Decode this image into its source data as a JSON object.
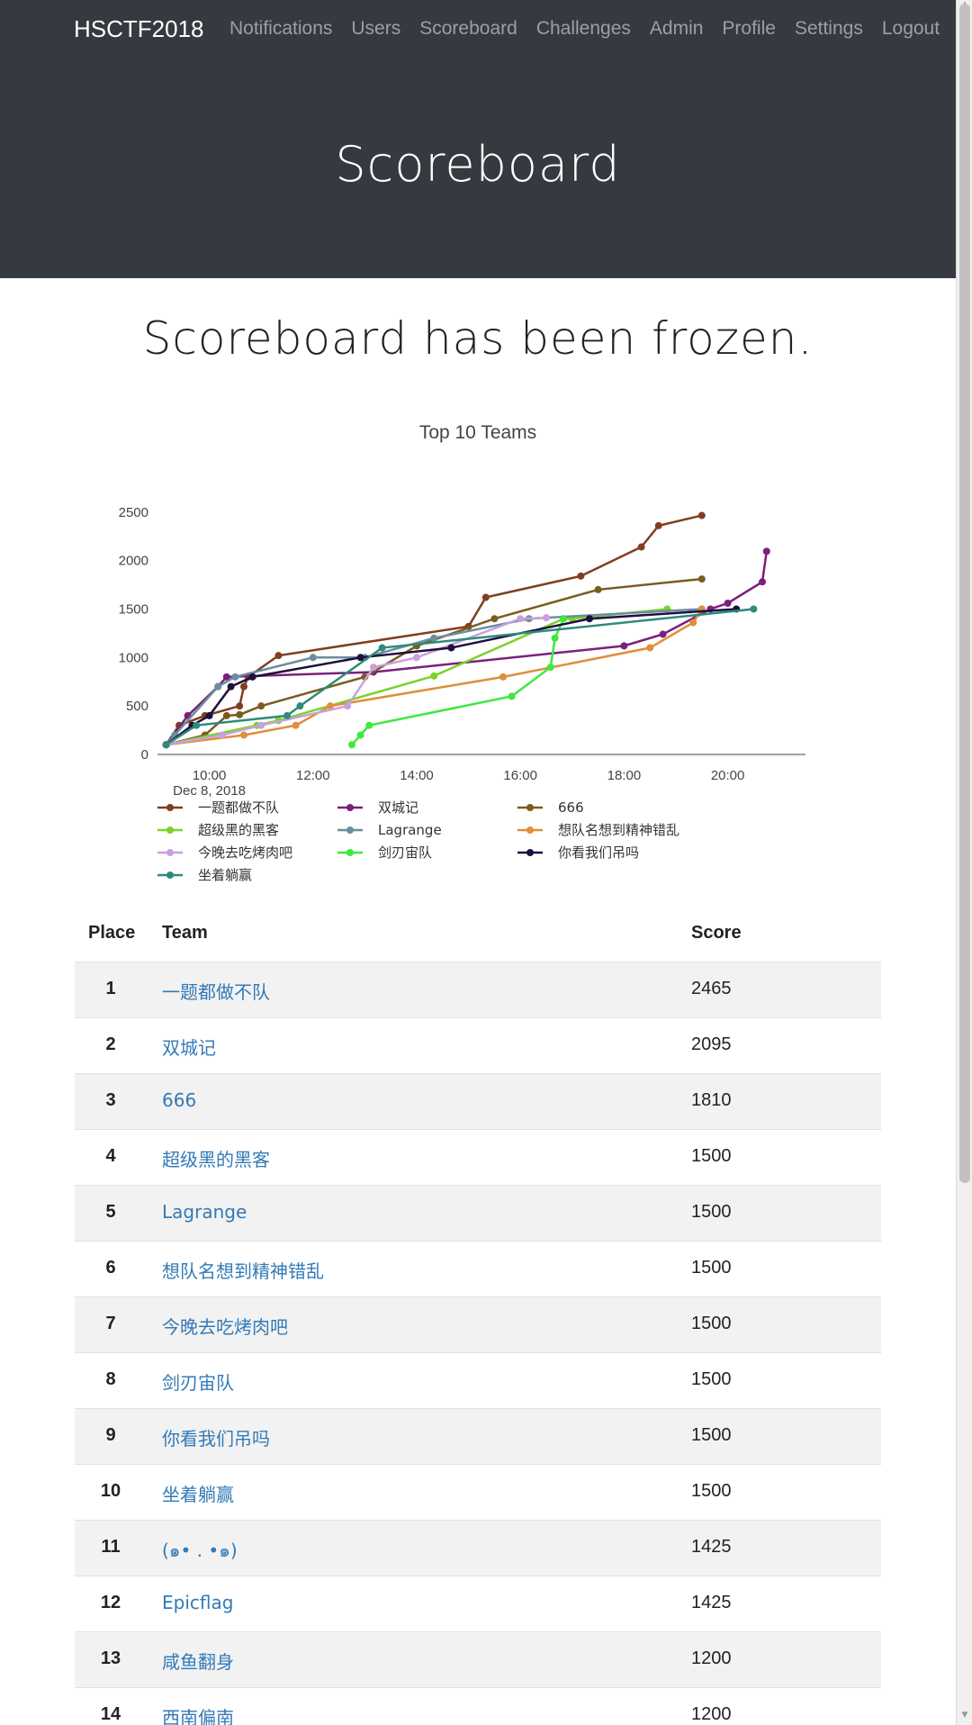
{
  "navbar": {
    "brand": "HSCTF2018",
    "links": [
      "Notifications",
      "Users",
      "Scoreboard",
      "Challenges",
      "Admin",
      "Profile",
      "Settings",
      "Logout"
    ]
  },
  "hero": {
    "title": "Scoreboard"
  },
  "notice": "Scoreboard has been frozen.",
  "chart_data": {
    "type": "line",
    "title": "Top 10 Teams",
    "xlabel": "",
    "ylabel": "",
    "x_axis_type": "time",
    "x_ticks": [
      "10:00",
      "12:00",
      "14:00",
      "16:00",
      "18:00",
      "20:00"
    ],
    "x_date_label": "Dec 8, 2018",
    "xlim": [
      "09:00",
      "21:30"
    ],
    "y_ticks": [
      0,
      500,
      1000,
      1500,
      2000,
      2500
    ],
    "ylim": [
      0,
      2600
    ],
    "grid": false,
    "legend_position": "bottom",
    "series": [
      {
        "name": "一题都做不队",
        "color": "#7f3f1f",
        "points": [
          [
            "09:10",
            100
          ],
          [
            "09:25",
            300
          ],
          [
            "09:55",
            400
          ],
          [
            "10:35",
            500
          ],
          [
            "10:40",
            700
          ],
          [
            "10:45",
            800
          ],
          [
            "11:20",
            1020
          ],
          [
            "15:00",
            1320
          ],
          [
            "15:20",
            1620
          ],
          [
            "17:10",
            1840
          ],
          [
            "18:20",
            2140
          ],
          [
            "18:40",
            2360
          ],
          [
            "19:30",
            2465
          ]
        ]
      },
      {
        "name": "双城记",
        "color": "#7b1f7b",
        "points": [
          [
            "09:10",
            100
          ],
          [
            "09:35",
            400
          ],
          [
            "10:10",
            700
          ],
          [
            "10:20",
            800
          ],
          [
            "13:10",
            850
          ],
          [
            "18:00",
            1120
          ],
          [
            "18:45",
            1240
          ],
          [
            "19:40",
            1500
          ],
          [
            "20:00",
            1560
          ],
          [
            "20:40",
            1780
          ],
          [
            "20:45",
            2095
          ]
        ]
      },
      {
        "name": "666",
        "color": "#7a5c1f",
        "points": [
          [
            "09:10",
            100
          ],
          [
            "09:55",
            200
          ],
          [
            "10:20",
            400
          ],
          [
            "10:35",
            410
          ],
          [
            "11:00",
            500
          ],
          [
            "13:00",
            800
          ],
          [
            "14:00",
            1120
          ],
          [
            "15:30",
            1400
          ],
          [
            "17:30",
            1700
          ],
          [
            "19:30",
            1810
          ]
        ]
      },
      {
        "name": "超级黑的黑客",
        "color": "#7bd22c",
        "points": [
          [
            "09:10",
            100
          ],
          [
            "10:55",
            300
          ],
          [
            "11:20",
            350
          ],
          [
            "14:20",
            810
          ],
          [
            "16:50",
            1400
          ],
          [
            "17:00",
            1400
          ],
          [
            "18:50",
            1500
          ]
        ]
      },
      {
        "name": "Lagrange",
        "color": "#6b8e9e",
        "points": [
          [
            "09:10",
            100
          ],
          [
            "09:20",
            200
          ],
          [
            "10:10",
            700
          ],
          [
            "10:30",
            800
          ],
          [
            "12:00",
            1000
          ],
          [
            "13:00",
            1000
          ],
          [
            "14:20",
            1200
          ],
          [
            "16:10",
            1400
          ],
          [
            "19:30",
            1500
          ]
        ]
      },
      {
        "name": "想队名想到精神错乱",
        "color": "#e08e3a",
        "points": [
          [
            "09:10",
            100
          ],
          [
            "10:40",
            200
          ],
          [
            "11:40",
            300
          ],
          [
            "12:20",
            500
          ],
          [
            "15:40",
            800
          ],
          [
            "18:30",
            1100
          ],
          [
            "19:20",
            1360
          ],
          [
            "19:30",
            1500
          ]
        ]
      },
      {
        "name": "今晚去吃烤肉吧",
        "color": "#c9a0dc",
        "points": [
          [
            "09:10",
            100
          ],
          [
            "10:15",
            200
          ],
          [
            "11:00",
            300
          ],
          [
            "12:40",
            500
          ],
          [
            "13:10",
            900
          ],
          [
            "14:00",
            1000
          ],
          [
            "16:00",
            1400
          ],
          [
            "16:30",
            1410
          ]
        ]
      },
      {
        "name": "剑刃宙队",
        "color": "#3ee83e",
        "points": [
          [
            "12:45",
            100
          ],
          [
            "12:55",
            200
          ],
          [
            "13:05",
            300
          ],
          [
            "15:50",
            600
          ],
          [
            "16:35",
            900
          ],
          [
            "16:40",
            1200
          ],
          [
            "16:50",
            1400
          ]
        ]
      },
      {
        "name": "你看我们吊吗",
        "color": "#1f0f3f",
        "points": [
          [
            "09:10",
            100
          ],
          [
            "09:40",
            300
          ],
          [
            "10:00",
            400
          ],
          [
            "10:25",
            700
          ],
          [
            "10:50",
            800
          ],
          [
            "12:55",
            1000
          ],
          [
            "14:40",
            1100
          ],
          [
            "17:20",
            1400
          ],
          [
            "20:10",
            1500
          ]
        ]
      },
      {
        "name": "坐着躺赢",
        "color": "#2e8b7a",
        "points": [
          [
            "09:10",
            100
          ],
          [
            "09:45",
            300
          ],
          [
            "11:30",
            400
          ],
          [
            "11:45",
            500
          ],
          [
            "13:20",
            1100
          ],
          [
            "20:30",
            1500
          ]
        ]
      }
    ]
  },
  "table": {
    "headers": {
      "place": "Place",
      "team": "Team",
      "score": "Score"
    },
    "rows": [
      {
        "place": "1",
        "team": "一题都做不队",
        "score": "2465"
      },
      {
        "place": "2",
        "team": "双城记",
        "score": "2095"
      },
      {
        "place": "3",
        "team": "666",
        "score": "1810"
      },
      {
        "place": "4",
        "team": "超级黑的黑客",
        "score": "1500"
      },
      {
        "place": "5",
        "team": "Lagrange",
        "score": "1500"
      },
      {
        "place": "6",
        "team": "想队名想到精神错乱",
        "score": "1500"
      },
      {
        "place": "7",
        "team": "今晚去吃烤肉吧",
        "score": "1500"
      },
      {
        "place": "8",
        "team": "剑刃宙队",
        "score": "1500"
      },
      {
        "place": "9",
        "team": "你看我们吊吗",
        "score": "1500"
      },
      {
        "place": "10",
        "team": "坐着躺赢",
        "score": "1500"
      },
      {
        "place": "11",
        "team": "(๑• . •๑)",
        "score": "1425"
      },
      {
        "place": "12",
        "team": "Epicflag",
        "score": "1425"
      },
      {
        "place": "13",
        "team": "咸鱼翻身",
        "score": "1200"
      },
      {
        "place": "14",
        "team": "西南偏南",
        "score": "1200"
      }
    ]
  },
  "colors": {
    "navbar_bg": "#343a40",
    "link": "#337ab7",
    "row_stripe": "#f2f2f2"
  }
}
